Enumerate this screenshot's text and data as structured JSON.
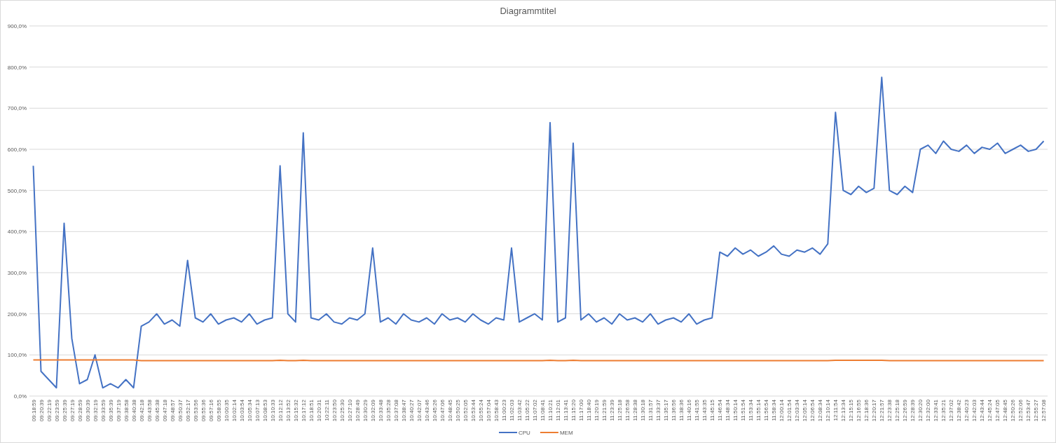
{
  "chart": {
    "chart_data": {
      "type": "line",
      "title": "Diagrammtitel",
      "categories": [
        "09:18:59",
        "09:20:39",
        "09:22:19",
        "09:23:59",
        "09:25:39",
        "09:27:19",
        "09:28:59",
        "09:30:39",
        "09:32:19",
        "09:33:59",
        "09:35:39",
        "09:37:19",
        "09:38:58",
        "09:40:38",
        "09:42:18",
        "09:43:58",
        "09:45:38",
        "09:47:18",
        "09:48:57",
        "09:50:37",
        "09:52:17",
        "09:53:56",
        "09:55:36",
        "09:57:16",
        "09:58:55",
        "10:00:35",
        "10:02:14",
        "10:03:54",
        "10:05:34",
        "10:07:13",
        "10:08:53",
        "10:10:33",
        "10:12:12",
        "10:13:52",
        "10:15:32",
        "10:17:12",
        "10:18:51",
        "10:20:31",
        "10:22:11",
        "10:23:50",
        "10:25:30",
        "10:27:10",
        "10:28:49",
        "10:30:29",
        "10:32:09",
        "10:33:48",
        "10:35:28",
        "10:37:08",
        "10:38:47",
        "10:40:27",
        "10:42:07",
        "10:43:46",
        "10:45:26",
        "10:47:06",
        "10:48:45",
        "10:50:25",
        "10:52:05",
        "10:53:44",
        "10:55:24",
        "10:57:04",
        "10:58:43",
        "11:00:23",
        "11:02:03",
        "11:03:42",
        "11:05:22",
        "11:07:02",
        "11:08:41",
        "11:10:21",
        "11:12:01",
        "11:13:41",
        "11:15:20",
        "11:17:00",
        "11:18:40",
        "11:20:19",
        "11:21:59",
        "11:23:39",
        "11:25:18",
        "11:26:58",
        "11:28:38",
        "11:30:18",
        "11:31:57",
        "11:33:37",
        "11:35:17",
        "11:36:56",
        "11:38:36",
        "11:40:16",
        "11:41:55",
        "11:43:35",
        "11:45:15",
        "11:46:54",
        "11:48:34",
        "11:50:14",
        "11:51:54",
        "11:53:34",
        "11:55:14",
        "11:56:54",
        "11:58:34",
        "12:00:14",
        "12:01:54",
        "12:03:34",
        "12:05:14",
        "12:06:54",
        "12:08:34",
        "12:10:14",
        "12:11:54",
        "12:13:34",
        "12:15:15",
        "12:16:55",
        "12:18:36",
        "12:20:17",
        "12:21:57",
        "12:23:38",
        "12:25:18",
        "12:26:59",
        "12:28:39",
        "12:30:20",
        "12:32:00",
        "12:33:41",
        "12:35:21",
        "12:37:02",
        "12:38:42",
        "12:40:23",
        "12:42:03",
        "12:43:44",
        "12:45:24",
        "12:47:05",
        "12:48:45",
        "12:50:26",
        "12:52:06",
        "12:53:47",
        "12:55:27",
        "12:57:08"
      ],
      "series": [
        {
          "name": "CPU",
          "color": "#4472c4",
          "values": [
            560,
            60,
            40,
            20,
            420,
            140,
            30,
            40,
            100,
            20,
            30,
            20,
            40,
            20,
            170,
            180,
            200,
            175,
            185,
            170,
            330,
            190,
            180,
            200,
            175,
            185,
            190,
            180,
            200,
            175,
            185,
            190,
            560,
            200,
            180,
            640,
            190,
            185,
            200,
            180,
            175,
            190,
            185,
            200,
            360,
            180,
            190,
            175,
            200,
            185,
            180,
            190,
            175,
            200,
            185,
            190,
            180,
            200,
            185,
            175,
            190,
            185,
            360,
            180,
            190,
            200,
            185,
            665,
            180,
            190,
            615,
            185,
            200,
            180,
            190,
            175,
            200,
            185,
            190,
            180,
            200,
            175,
            185,
            190,
            180,
            200,
            175,
            185,
            190,
            350,
            340,
            360,
            345,
            355,
            340,
            350,
            365,
            345,
            340,
            355,
            350,
            360,
            345,
            370,
            690,
            500,
            490,
            510,
            495,
            505,
            775,
            500,
            490,
            510,
            495,
            600,
            610,
            590,
            620,
            600,
            595,
            610,
            590,
            605,
            600,
            615,
            590,
            600,
            610,
            595,
            600,
            620
          ]
        },
        {
          "name": "MEM",
          "color": "#ed7d31",
          "values": [
            88,
            88,
            88,
            88,
            88,
            88,
            88,
            88,
            88,
            88,
            88,
            88,
            88,
            88,
            86,
            86,
            86,
            86,
            86,
            86,
            86,
            86,
            86,
            86,
            86,
            86,
            86,
            86,
            86,
            86,
            86,
            86,
            87,
            86,
            86,
            87,
            86,
            86,
            86,
            86,
            86,
            86,
            86,
            86,
            86,
            86,
            86,
            86,
            86,
            86,
            86,
            86,
            86,
            86,
            86,
            86,
            86,
            86,
            86,
            86,
            86,
            86,
            86,
            86,
            86,
            86,
            86,
            87,
            86,
            86,
            87,
            86,
            86,
            86,
            86,
            86,
            86,
            86,
            86,
            86,
            86,
            86,
            86,
            86,
            86,
            86,
            86,
            86,
            86,
            86,
            86,
            86,
            86,
            86,
            86,
            86,
            86,
            86,
            86,
            86,
            86,
            86,
            86,
            86,
            87,
            87,
            87,
            87,
            87,
            87,
            87,
            86,
            86,
            86,
            86,
            86,
            86,
            86,
            86,
            86,
            86,
            86,
            86,
            86,
            86,
            86,
            86,
            86,
            86,
            86,
            86,
            86
          ]
        }
      ],
      "ylim": [
        0,
        900
      ],
      "grid": true,
      "legend": "bottom",
      "yticks": [
        {
          "value": 0,
          "label": "0,0%"
        },
        {
          "value": 100,
          "label": "100,0%"
        },
        {
          "value": 200,
          "label": "200,0%"
        },
        {
          "value": 300,
          "label": "300,0%"
        },
        {
          "value": 400,
          "label": "400,0%"
        },
        {
          "value": 500,
          "label": "500,0%"
        },
        {
          "value": 600,
          "label": "600,0%"
        },
        {
          "value": 700,
          "label": "700,0%"
        },
        {
          "value": 800,
          "label": "800,0%"
        },
        {
          "value": 900,
          "label": "900,0%"
        }
      ]
    }
  }
}
